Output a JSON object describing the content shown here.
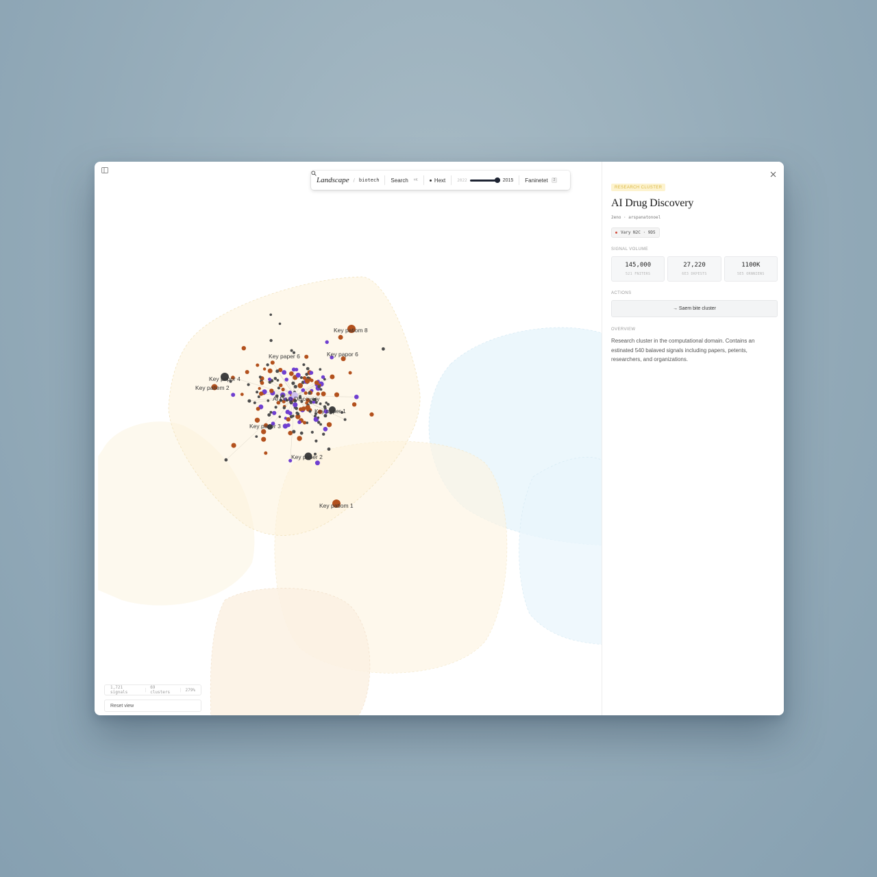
{
  "toolbar": {
    "brand": "Landscape",
    "separator": "/",
    "workspace": "biotech",
    "search_label": "Search",
    "search_shortcut": "⌘K",
    "next_label": "Hext",
    "year_start": "2022",
    "year_end": "2015",
    "filter_label": "Faninetet",
    "filter_count": "2"
  },
  "map": {
    "center_label": "AI Drug Discovery",
    "labels": [
      "Key patiom 8",
      "Key paper 6",
      "Key papor 6",
      "Key papor 4",
      "Key patiem 2",
      "Key paper 1",
      "Key paper 3",
      "Key paper 2",
      "Key patiom 1"
    ],
    "colors": {
      "paper": "#4d4d4d",
      "patent": "#b3511d",
      "organization": "#6f3fd0",
      "hub": "#3f3f3f",
      "cluster_fill": "#fdf3da",
      "cluster_alt": "#e6f4fb"
    }
  },
  "stats": {
    "signals": "1,721 signals",
    "clusters": "69 clusters",
    "zoom": "279%"
  },
  "reset_label": "Reset view",
  "side": {
    "category": "RESEARCH CLUSTER",
    "title": "AI Drug Discovery",
    "subtitle": "2eno · arspanatonoel",
    "chip": "Vary N2C · 9D5",
    "signal_volume_label": "SIGNAL VOLUME",
    "metrics": [
      {
        "value": "145,000",
        "label": "521 FNITERS"
      },
      {
        "value": "27,220",
        "label": "6E3 DKPESTS"
      },
      {
        "value": "1100K",
        "label": "5E5 ORNNIENS"
      }
    ],
    "actions_label": "ACTIONS",
    "action_button": "→ Saem bite cluster",
    "overview_label": "OVERVIEW",
    "overview_text": "Research cluster in the computational domain. Contains an estinated 540 balaved signals including papers, petents, researchers, and organizations."
  }
}
